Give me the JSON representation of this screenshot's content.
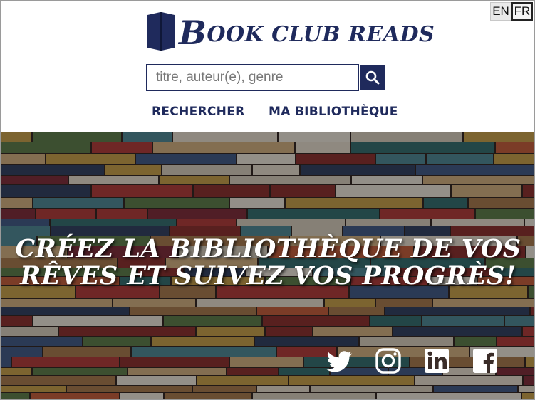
{
  "language": {
    "options": [
      "EN",
      "FR"
    ],
    "active": "FR"
  },
  "header": {
    "logo_initial": "B",
    "logo_rest": "OOK CLUB READS"
  },
  "search": {
    "placeholder": "titre, auteur(e), genre"
  },
  "nav": {
    "search_label": "RECHERCHER",
    "library_label": "MA BIBLIOTHÈQUE"
  },
  "hero": {
    "tagline_line1": "Créez la bibliothèque de vos",
    "tagline_line2": "rêves et suivez vos progrès!"
  },
  "socials": [
    "twitter-icon",
    "instagram-icon",
    "linkedin-icon",
    "facebook-icon"
  ],
  "colors": {
    "brand": "#1f2a5c",
    "hero_text": "#ffffff"
  }
}
